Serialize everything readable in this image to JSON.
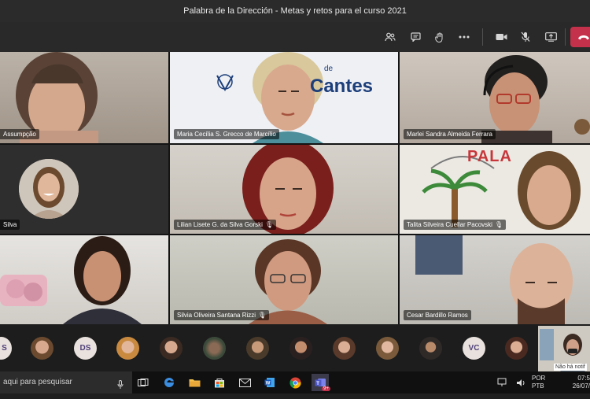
{
  "window": {
    "title": "Palabra de la Dirección - Metas y retos para el curso 2021"
  },
  "toolbar": {
    "icons": [
      "participants-icon",
      "chat-icon",
      "raise-hand-icon",
      "more-icon",
      "camera-icon",
      "mic-off-icon",
      "share-icon",
      "hangup-icon"
    ]
  },
  "participants": {
    "t1": "Assumpção",
    "t2": "Maria Cecília S. Grecco de Marcílio",
    "t2_logo": "Cantes",
    "t2_logo_small": "de",
    "t3": "Marlei Sandra Almeida Ferrara",
    "t4": "Silva",
    "t5": "Lilian Lisete G. da Silva Gorski",
    "t6": "Talita Silveira Cuellar Pacovski",
    "t6_wall": "PALA",
    "t7": "Silvia Oliveira Santana Rizzi",
    "t9": "Cesar Bardillo Ramos"
  },
  "strip": {
    "initials_a": "S",
    "initials_b": "DS",
    "initials_c": "VC",
    "self_notice": "Não há notif"
  },
  "taskbar": {
    "search_placeholder": "aqui para pesquisar",
    "lang_1": "POR",
    "lang_2": "PTB",
    "time": "07:5",
    "date": "26/07/",
    "teams_badge": "9+"
  }
}
